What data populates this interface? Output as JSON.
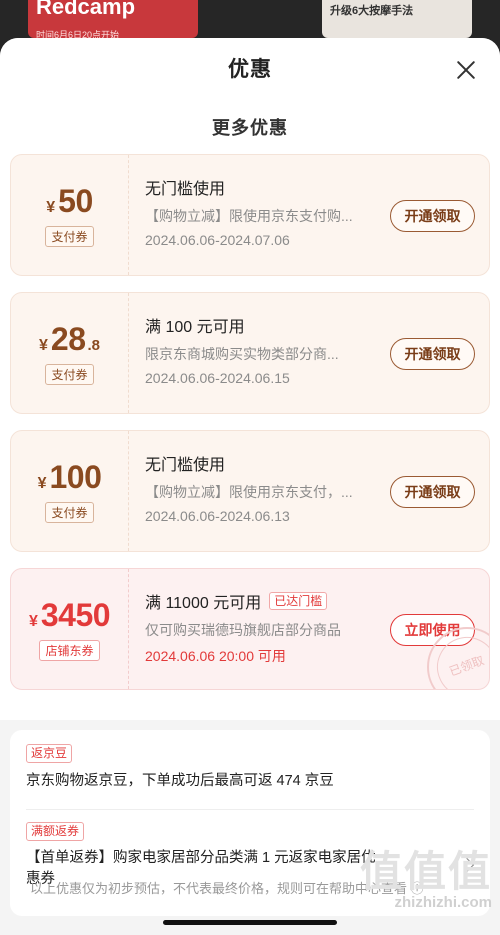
{
  "background": {
    "banner_left": "Redcamp",
    "banner_left_sub": "时间6月6日20点开始",
    "banner_right": "升级6大按摩手法"
  },
  "sheet": {
    "title": "优惠",
    "close_icon": "close-icon"
  },
  "section_title": "更多优惠",
  "coupons": [
    {
      "currency": "¥",
      "amount": "50",
      "amount_decimal": "",
      "type": "支付券",
      "title": "无门槛使用",
      "badge": "",
      "description": "【购物立减】限使用京东支付购...",
      "date": "2024.06.06-2024.07.06",
      "button": "开通领取"
    },
    {
      "currency": "¥",
      "amount": "28",
      "amount_decimal": ".8",
      "type": "支付券",
      "title": "满 100 元可用",
      "badge": "",
      "description": "限京东商城购买实物类部分商...",
      "date": "2024.06.06-2024.06.15",
      "button": "开通领取"
    },
    {
      "currency": "¥",
      "amount": "100",
      "amount_decimal": "",
      "type": "支付券",
      "title": "无门槛使用",
      "badge": "",
      "description": "【购物立减】限使用京东支付，...",
      "date": "2024.06.06-2024.06.13",
      "button": "开通领取"
    },
    {
      "currency": "¥",
      "amount": "3450",
      "amount_decimal": "",
      "type": "店铺东券",
      "title": "满 11000 元可用",
      "badge": "已达门槛",
      "description": "仅可购买瑞德玛旗舰店部分商品",
      "date": "2024.06.06 20:00 可用",
      "button": "立即使用",
      "stamp": "已领取"
    }
  ],
  "info": {
    "tag1": "返京豆",
    "text1": "京东购物返京豆，下单成功后最高可返 474 京豆",
    "tag2": "满额返券",
    "text2": "【首单返券】购家电家居部分品类满 1 元返家电家居优惠券"
  },
  "footer_note": "以上优惠仅为初步预估，不代表最终价格，规则可在帮助中心查看 ⓘ",
  "watermark": {
    "glyphs": "值值值",
    "url": "zhizhizhi.com"
  },
  "colors": {
    "accent_brown": "#8a4a20",
    "accent_red": "#e23a3a"
  }
}
